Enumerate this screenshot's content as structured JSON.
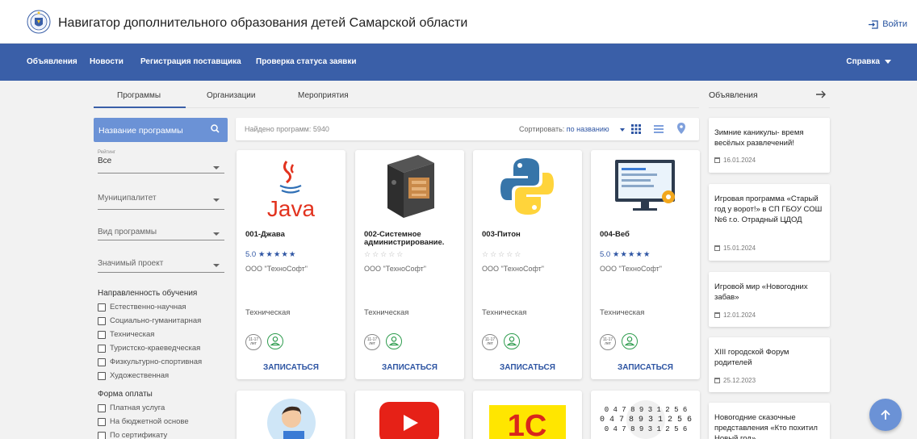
{
  "header": {
    "site_title": "Навигатор дополнительного образования детей Самарской области",
    "login_label": "Войти"
  },
  "nav": {
    "items": [
      "Объявления",
      "Новости",
      "Регистрация поставщика",
      "Проверка статуса заявки"
    ],
    "help_label": "Справка"
  },
  "tabs": {
    "items": [
      "Программы",
      "Организации",
      "Мероприятия"
    ],
    "active": "Программы"
  },
  "search": {
    "label": "Название программы"
  },
  "filters": {
    "rating_label": "Рейтинг",
    "rating_value": "Все",
    "municipality": "Муниципалитет",
    "program_type": "Вид программы",
    "significant_project": "Значимый проект",
    "direction_heading": "Направленность обучения",
    "directions": [
      "Естественно-научная",
      "Социально-гуманитарная",
      "Техническая",
      "Туристско-краеведческая",
      "Физкультурно-спортивная",
      "Художественная"
    ],
    "payment_heading": "Форма оплаты",
    "payments": [
      "Платная услуга",
      "На бюджетной основе",
      "По сертификату"
    ]
  },
  "results": {
    "found_text": "Найдено программ: 5940",
    "sort_label": "Сортировать:",
    "sort_value": "по названию"
  },
  "cards": [
    {
      "title": "001-Джава",
      "rating": "5.0",
      "rated": true,
      "org": "ООО \"ТехноСофт\"",
      "kind": "Техническая",
      "age": "11-17 лет",
      "enroll": "ЗАПИСАТЬСЯ",
      "image": "java-logo-icon"
    },
    {
      "title": "002-Системное администрирование.",
      "rating": "",
      "rated": false,
      "org": "ООО \"ТехноСофт\"",
      "kind": "Техническая",
      "age": "11-17 лет",
      "enroll": "ЗАПИСАТЬСЯ",
      "image": "server-icon"
    },
    {
      "title": "003-Питон",
      "rating": "",
      "rated": false,
      "org": "ООО \"ТехноСофт\"",
      "kind": "Техническая",
      "age": "11-17 лет",
      "enroll": "ЗАПИСАТЬСЯ",
      "image": "python-logo-icon"
    },
    {
      "title": "004-Веб",
      "rating": "5.0",
      "rated": true,
      "org": "ООО \"ТехноСофт\"",
      "kind": "Техническая",
      "age": "11-17 лет",
      "enroll": "ЗАПИСАТЬСЯ",
      "image": "web-monitor-icon"
    }
  ],
  "cards_row2_images": [
    "boy-laptop-icon",
    "youtube-logo-icon",
    "1c-logo-icon",
    "numbers-tree-icon"
  ],
  "cards_row2_texts": {
    "onec": "1С",
    "numbers": "0 4 7 8 9 3 1 2 5 6"
  },
  "announcements": {
    "heading": "Объявления",
    "items": [
      {
        "title": "Зимние каникулы- время весёлых развлечений!",
        "date": "16.01.2024"
      },
      {
        "title": "Игровая программа «Старый год у ворот!» в СП ГБОУ СОШ №6 г.о. Отрадный ЦДОД",
        "date": "15.01.2024"
      },
      {
        "title": "Игровой мир «Новогодних забав»",
        "date": "12.01.2024"
      },
      {
        "title": "XIII городской Форум родителей",
        "date": "25.12.2023"
      },
      {
        "title": "Новогодние сказочные представления «Кто похитил Новый год»",
        "date": ""
      }
    ]
  },
  "colors": {
    "nav_bg": "#3a5fa8",
    "accent": "#2e55a3",
    "search_bg": "#6b92d6",
    "page_bg": "#f2f2f2"
  }
}
